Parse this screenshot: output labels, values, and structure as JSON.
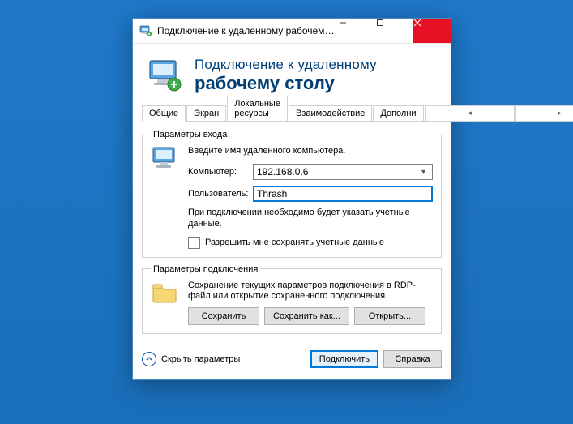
{
  "titlebar": {
    "title": "Подключение к удаленному рабочему с..."
  },
  "header": {
    "line1": "Подключение к удаленному",
    "line2": "рабочему столу"
  },
  "tabs": {
    "items": [
      {
        "label": "Общие"
      },
      {
        "label": "Экран"
      },
      {
        "label": "Локальные ресурсы"
      },
      {
        "label": "Взаимодействие"
      },
      {
        "label": "Дополни"
      }
    ]
  },
  "login_group": {
    "legend": "Параметры входа",
    "intro": "Введите имя удаленного компьютера.",
    "computer_label": "Компьютер:",
    "computer_value": "192.168.0.6",
    "user_label": "Пользователь:",
    "user_value": "Thrash",
    "note": "При подключении необходимо будет указать учетные данные.",
    "checkbox_label": "Разрешить мне сохранять учетные данные"
  },
  "conn_group": {
    "legend": "Параметры подключения",
    "desc": "Сохранение текущих параметров подключения в RDP-файл или открытие сохраненного подключения.",
    "save": "Сохранить",
    "save_as": "Сохранить как...",
    "open": "Открыть..."
  },
  "footer": {
    "collapse": "Скрыть параметры",
    "connect": "Подключить",
    "help": "Справка"
  }
}
